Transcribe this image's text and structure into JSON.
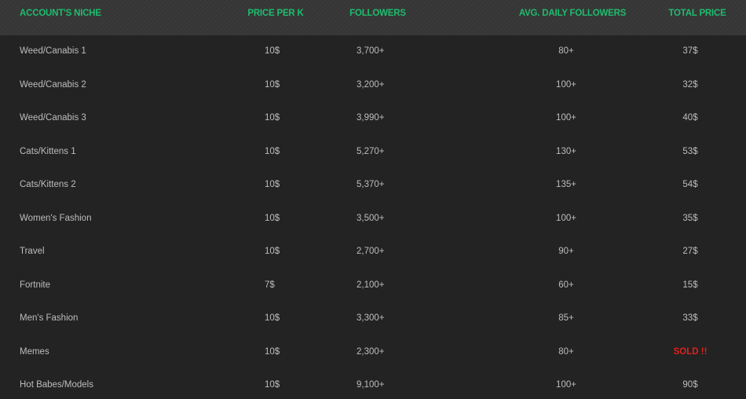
{
  "columns": {
    "niche": "ACCOUNT'S NICHE",
    "price_per_k": "PRICE PER K",
    "followers": "FOLLOWERS",
    "avg_daily": "AVG. DAILY FOLLOWERS",
    "total": "TOTAL PRICE"
  },
  "colors": {
    "header_text": "#1ebc6e",
    "body_text": "#bdbdbd",
    "sold": "#e0211b",
    "background": "#232323"
  },
  "rows": [
    {
      "niche": "Weed/Canabis 1",
      "price_per_k": "10$",
      "followers": "3,700+",
      "avg_daily": "80+",
      "total": "37$",
      "sold": false
    },
    {
      "niche": "Weed/Canabis 2",
      "price_per_k": "10$",
      "followers": "3,200+",
      "avg_daily": "100+",
      "total": "32$",
      "sold": false
    },
    {
      "niche": "Weed/Canabis 3",
      "price_per_k": "10$",
      "followers": "3,990+",
      "avg_daily": "100+",
      "total": "40$",
      "sold": false
    },
    {
      "niche": "Cats/Kittens 1",
      "price_per_k": "10$",
      "followers": "5,270+",
      "avg_daily": "130+",
      "total": "53$",
      "sold": false
    },
    {
      "niche": "Cats/Kittens 2",
      "price_per_k": "10$",
      "followers": "5,370+",
      "avg_daily": "135+",
      "total": "54$",
      "sold": false
    },
    {
      "niche": "Women's Fashion",
      "price_per_k": "10$",
      "followers": "3,500+",
      "avg_daily": "100+",
      "total": "35$",
      "sold": false
    },
    {
      "niche": "Travel",
      "price_per_k": "10$",
      "followers": "2,700+",
      "avg_daily": "90+",
      "total": "27$",
      "sold": false
    },
    {
      "niche": "Fortnite",
      "price_per_k": "7$",
      "followers": "2,100+",
      "avg_daily": "60+",
      "total": "15$",
      "sold": false
    },
    {
      "niche": "Men's Fashion",
      "price_per_k": "10$",
      "followers": "3,300+",
      "avg_daily": "85+",
      "total": "33$",
      "sold": false
    },
    {
      "niche": "Memes",
      "price_per_k": "10$",
      "followers": "2,300+",
      "avg_daily": "80+",
      "total": "SOLD !!",
      "sold": true
    },
    {
      "niche": "Hot Babes/Models",
      "price_per_k": "10$",
      "followers": "9,100+",
      "avg_daily": "100+",
      "total": "90$",
      "sold": false
    }
  ]
}
